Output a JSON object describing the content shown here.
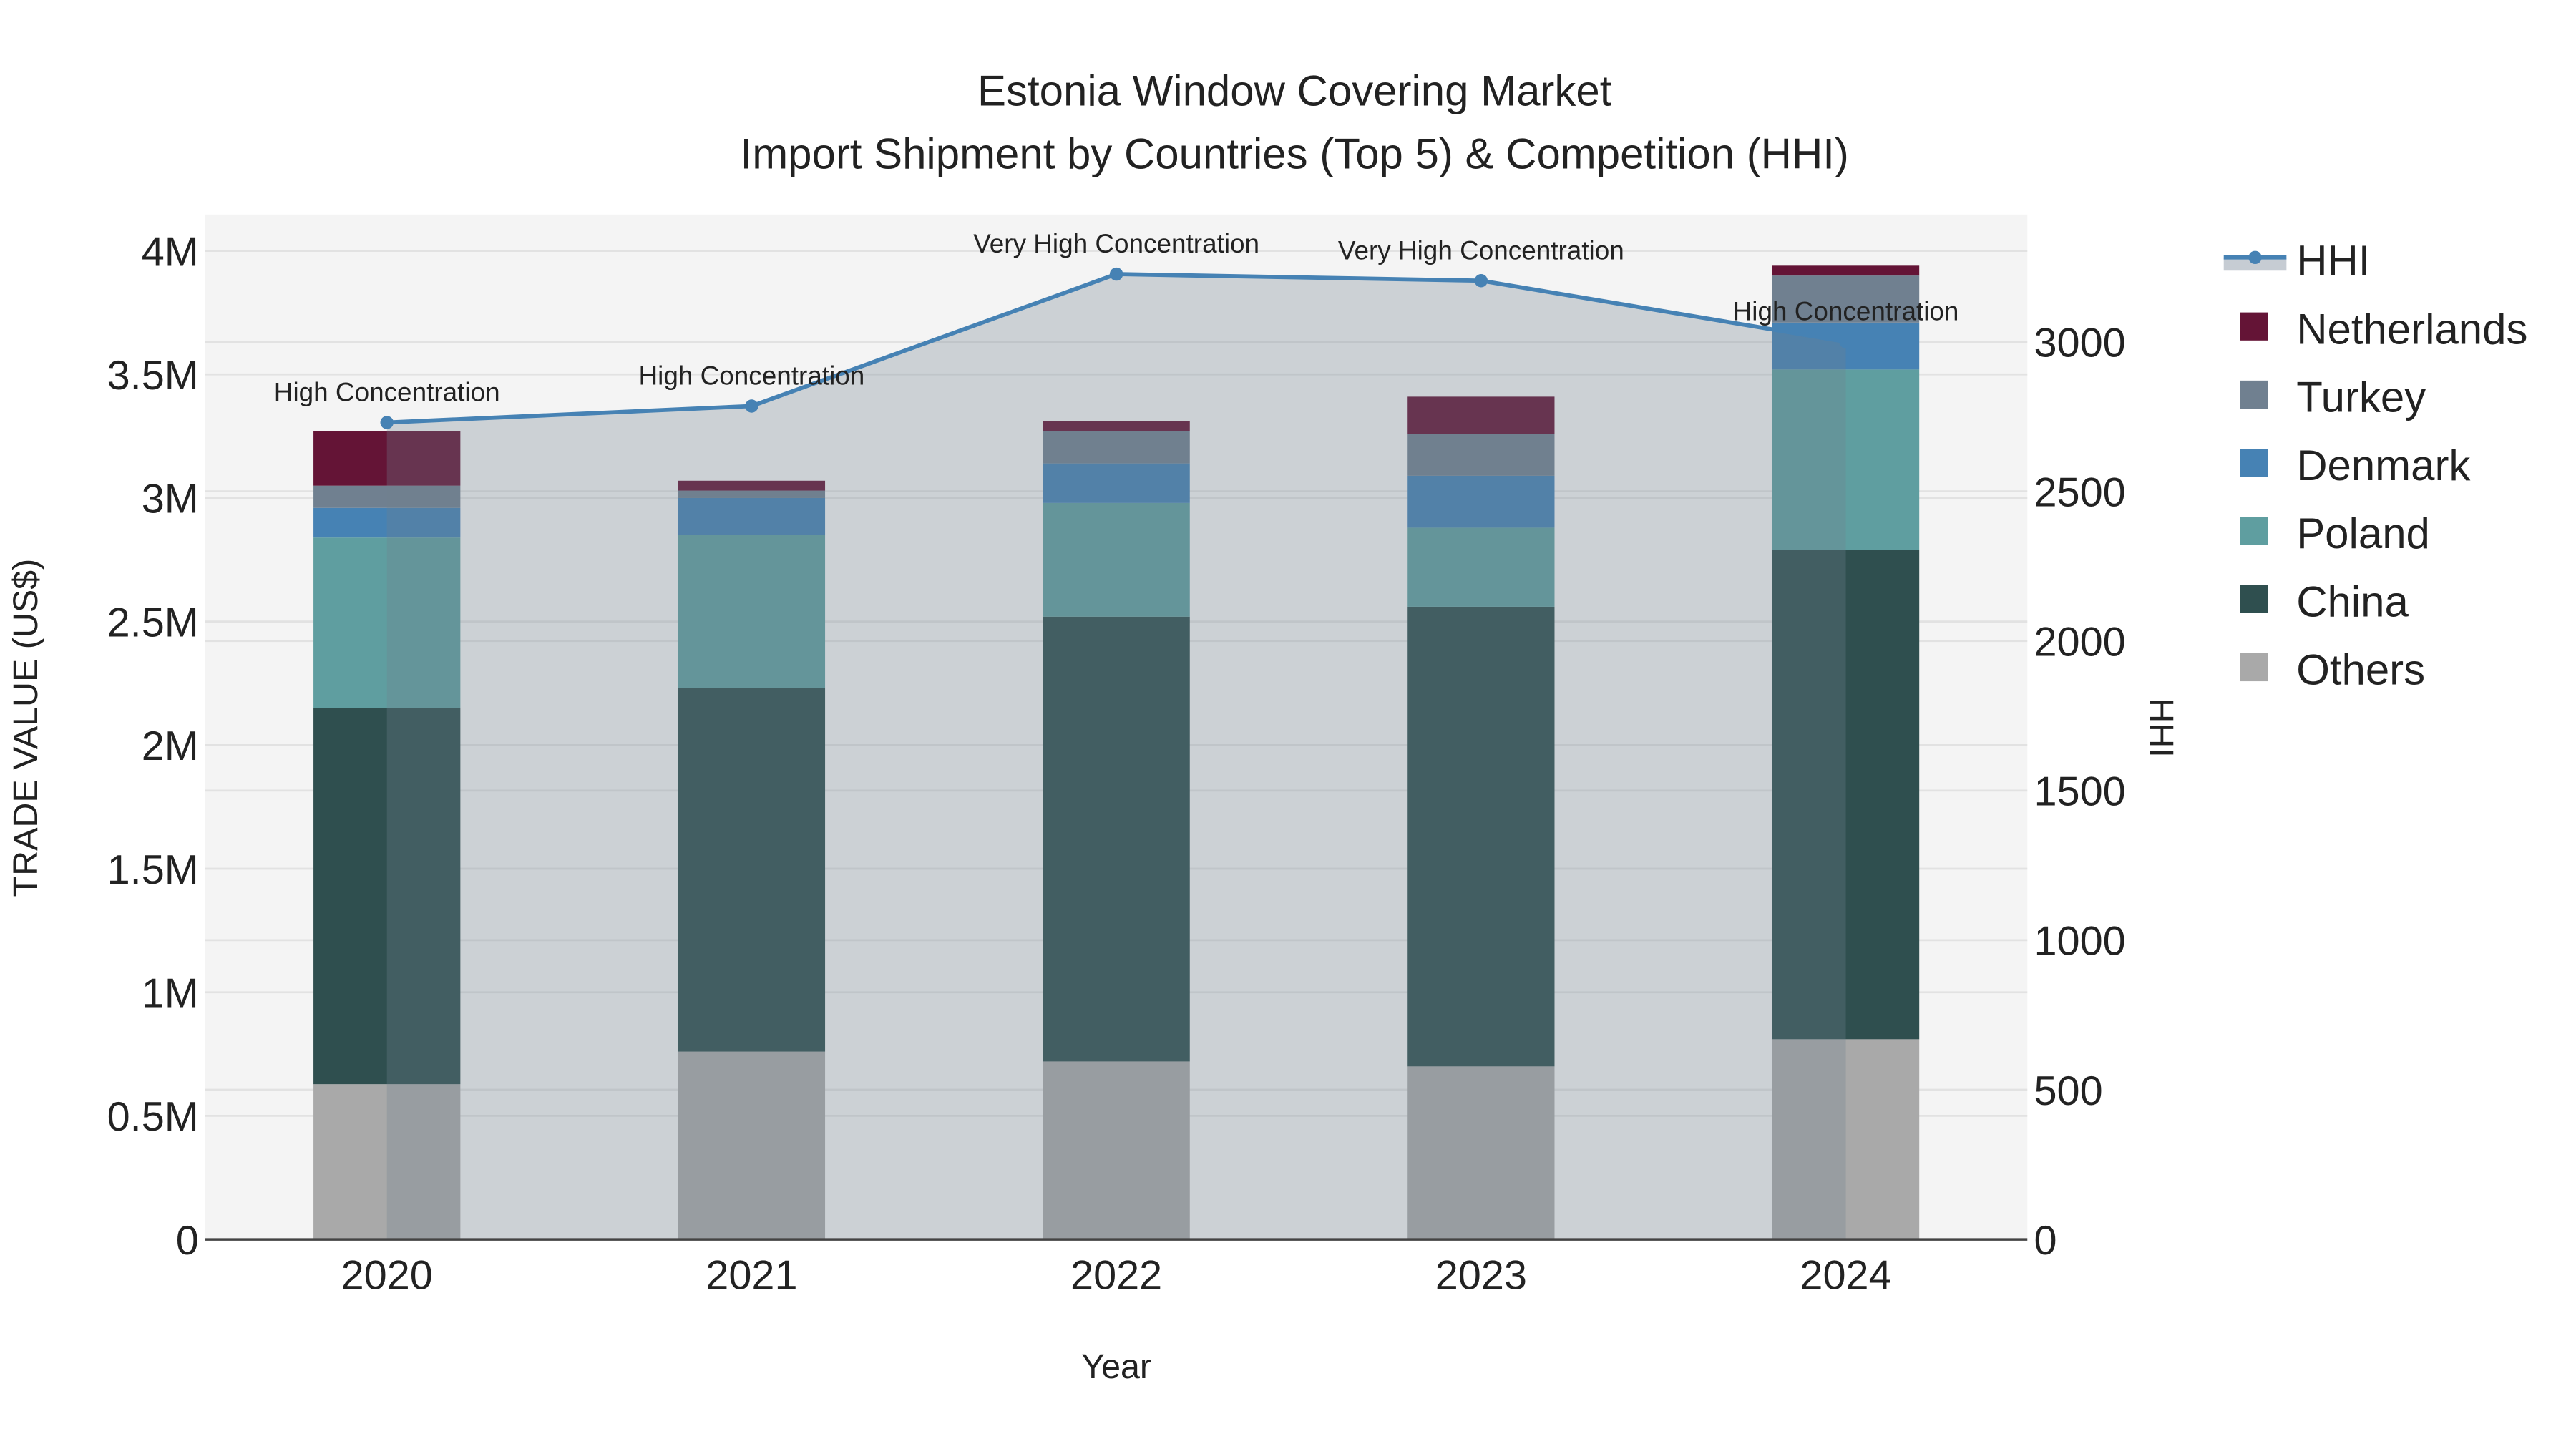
{
  "chart_data": {
    "type": "bar",
    "title_line1": "Estonia Window Covering Market",
    "title_line2": "Import Shipment by Countries (Top 5) & Competition (HHI)",
    "xlabel": "Year",
    "ylabel": "TRADE VALUE (US$)",
    "y2label": "HHI",
    "categories": [
      "2020",
      "2021",
      "2022",
      "2023",
      "2024"
    ],
    "ylim": [
      0,
      4147000
    ],
    "y2lim": [
      0,
      3425
    ],
    "yticks": [
      0,
      500000,
      1000000,
      1500000,
      2000000,
      2500000,
      3000000,
      3500000,
      4000000
    ],
    "ytick_labels": [
      "0",
      "0.5M",
      "1M",
      "1.5M",
      "2M",
      "2.5M",
      "3M",
      "3.5M",
      "4M"
    ],
    "y2ticks": [
      0,
      500,
      1000,
      1500,
      2000,
      2500,
      3000
    ],
    "y2tick_labels": [
      "0",
      "500",
      "1000",
      "1500",
      "2000",
      "2500",
      "3000"
    ],
    "grid": true,
    "stacked": true,
    "series": [
      {
        "name": "Others",
        "color": "#A9A9A9",
        "values": [
          628000,
          760000,
          720000,
          700000,
          810000
        ]
      },
      {
        "name": "China",
        "color": "#2F4F4F",
        "values": [
          1522000,
          1470000,
          1800000,
          1860000,
          1980000
        ]
      },
      {
        "name": "Poland",
        "color": "#5F9EA0",
        "values": [
          690000,
          620000,
          460000,
          320000,
          730000
        ]
      },
      {
        "name": "Denmark",
        "color": "#4682B4",
        "values": [
          120000,
          150000,
          160000,
          210000,
          190000
        ]
      },
      {
        "name": "Turkey",
        "color": "#708090",
        "values": [
          90000,
          30000,
          130000,
          170000,
          190000
        ]
      },
      {
        "name": "Netherlands",
        "color": "#641436",
        "values": [
          220000,
          40000,
          40000,
          150000,
          40000
        ]
      }
    ],
    "hhi": {
      "name": "HHI",
      "color": "#4682B4",
      "values": [
        2730,
        2785,
        3226,
        3204,
        3000
      ],
      "annotations": [
        "High Concentration",
        "High Concentration",
        "Very High Concentration",
        "Very High Concentration",
        "High Concentration"
      ]
    },
    "legend_order": [
      "HHI",
      "Netherlands",
      "Turkey",
      "Denmark",
      "Poland",
      "China",
      "Others"
    ],
    "legend_position": "right"
  }
}
